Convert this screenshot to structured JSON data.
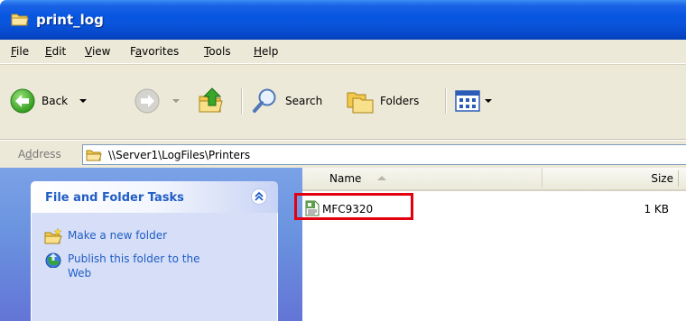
{
  "window": {
    "title": "print_log"
  },
  "menu": {
    "items": [
      {
        "key": "F",
        "rest": "ile"
      },
      {
        "key": "E",
        "rest": "dit"
      },
      {
        "key": "V",
        "rest": "iew"
      },
      {
        "pre": "F",
        "key": "a",
        "rest": "vorites"
      },
      {
        "key": "T",
        "rest": "ools"
      },
      {
        "key": "H",
        "rest": "elp"
      }
    ]
  },
  "toolbar": {
    "back_label": "Back",
    "search_label": "Search",
    "folders_label": "Folders"
  },
  "address": {
    "label_pre": "A",
    "label_key": "d",
    "label_rest": "dress",
    "path": "\\\\Server1\\LogFiles\\Printers"
  },
  "tasks": {
    "title": "File and Folder Tasks",
    "items": [
      {
        "label": "Make a new folder",
        "icon": "new-folder-icon"
      },
      {
        "label": "Publish this folder to the Web",
        "icon": "publish-web-icon"
      }
    ]
  },
  "list": {
    "columns": {
      "name": "Name",
      "size": "Size"
    },
    "files": [
      {
        "name": "MFC9320",
        "size": "1 KB",
        "icon": "log-file-icon"
      }
    ]
  },
  "colors": {
    "title_bar": "#0a55dc",
    "highlight": "#e3000f",
    "task_link": "#215dc6"
  }
}
